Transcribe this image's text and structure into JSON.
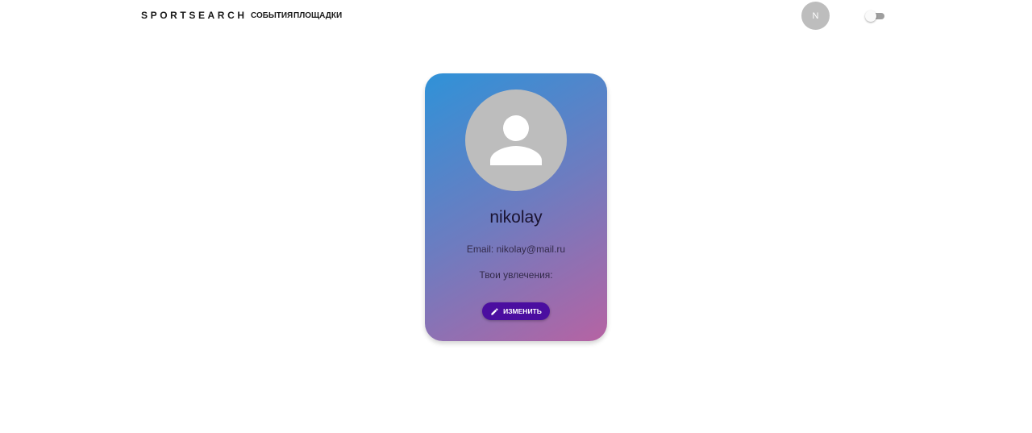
{
  "navbar": {
    "brand": "SPORTSEARCH",
    "links": [
      {
        "label": "СОБЫТИЯ"
      },
      {
        "label": "ПЛОЩАДКИ"
      }
    ],
    "avatar_initial": "N"
  },
  "profile": {
    "username": "nikolay",
    "email_label": "Email:",
    "email": "nikolay@mail.ru",
    "hobbies_label": "Твои увлечения:",
    "edit_label": "ИЗМЕНИТЬ"
  },
  "icons": {
    "avatar_placeholder": "person-icon",
    "edit": "pencil-icon"
  },
  "colors": {
    "card_gradient_start": "#2f92d8",
    "card_gradient_end": "#b663a3",
    "edit_button": "#4b0ea0",
    "avatar_bg": "#bdbdbd"
  }
}
